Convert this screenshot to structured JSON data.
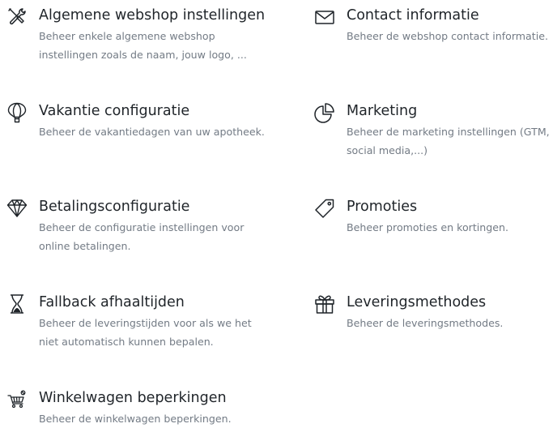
{
  "settings": {
    "items": [
      {
        "icon": "tools-icon",
        "title": "Algemene webshop instellingen",
        "description": "Beheer enkele algemene webshop instellingen zoals de naam, jouw logo, ..."
      },
      {
        "icon": "envelope-icon",
        "title": "Contact informatie",
        "description": "Beheer de webshop contact informatie."
      },
      {
        "icon": "hot-air-balloon-icon",
        "title": "Vakantie configuratie",
        "description": "Beheer de vakantiedagen van uw apotheek."
      },
      {
        "icon": "pie-chart-icon",
        "title": "Marketing",
        "description": "Beheer de marketing instellingen (GTM, social media,...)"
      },
      {
        "icon": "diamond-icon",
        "title": "Betalingsconfiguratie",
        "description": "Beheer de configuratie instellingen voor online betalingen."
      },
      {
        "icon": "tag-icon",
        "title": "Promoties",
        "description": "Beheer promoties en kortingen."
      },
      {
        "icon": "hourglass-icon",
        "title": "Fallback afhaaltijden",
        "description": "Beheer de leveringstijden voor als we het niet automatisch kunnen bepalen."
      },
      {
        "icon": "gift-icon",
        "title": "Leveringsmethodes",
        "description": "Beheer de leveringsmethodes."
      },
      {
        "icon": "shopping-cart-icon",
        "title": "Winkelwagen beperkingen",
        "description": "Beheer de winkelwagen beperkingen."
      }
    ]
  }
}
